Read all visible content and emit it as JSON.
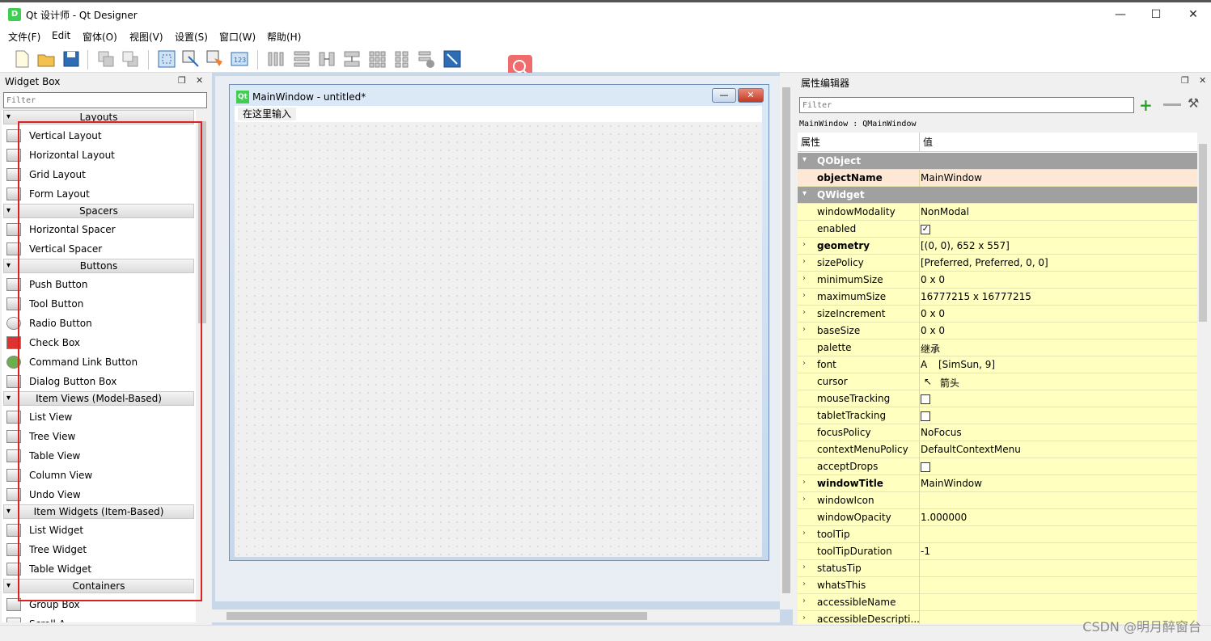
{
  "window": {
    "title": "Qt 设计师 - Qt Designer",
    "app_icon": "D",
    "controls": [
      "—",
      "☐",
      "✕"
    ]
  },
  "menu": [
    "文件(F)",
    "Edit",
    "窗体(O)",
    "视图(V)",
    "设置(S)",
    "窗口(W)",
    "帮助(H)"
  ],
  "widget_box": {
    "title": "Widget Box",
    "filter_placeholder": "Filter",
    "categories": {
      "layouts": "Layouts",
      "spacers": "Spacers",
      "buttons": "Buttons",
      "item_views": "Item Views (Model-Based)",
      "item_widgets": "Item Widgets (Item-Based)",
      "containers": "Containers"
    },
    "items": {
      "vertical_layout": "Vertical Layout",
      "horizontal_layout": "Horizontal Layout",
      "grid_layout": "Grid Layout",
      "form_layout": "Form Layout",
      "horizontal_spacer": "Horizontal Spacer",
      "vertical_spacer": "Vertical Spacer",
      "push_button": "Push Button",
      "tool_button": "Tool Button",
      "radio_button": "Radio Button",
      "check_box": "Check Box",
      "command_link_button": "Command Link Button",
      "dialog_button_box": "Dialog Button Box",
      "list_view": "List View",
      "tree_view": "Tree View",
      "table_view": "Table View",
      "column_view": "Column View",
      "undo_view": "Undo View",
      "list_widget": "List Widget",
      "tree_widget": "Tree Widget",
      "table_widget": "Table Widget",
      "group_box": "Group Box",
      "scroll_area": "Scroll A..."
    }
  },
  "form": {
    "title": "MainWindow - untitled*",
    "icon": "Qt",
    "menu_placeholder": "在这里输入"
  },
  "property_editor": {
    "title": "属性编辑器",
    "filter_placeholder": "Filter",
    "object_path": "MainWindow : QMainWindow",
    "col_property": "属性",
    "col_value": "值",
    "groups": {
      "qobject": "QObject",
      "qwidget": "QWidget"
    },
    "rows": {
      "objectName": {
        "name": "objectName",
        "value": "MainWindow"
      },
      "windowModality": {
        "name": "windowModality",
        "value": "NonModal"
      },
      "enabled": {
        "name": "enabled",
        "value": "✓"
      },
      "geometry": {
        "name": "geometry",
        "value": "[(0, 0), 652 x 557]"
      },
      "sizePolicy": {
        "name": "sizePolicy",
        "value": "[Preferred, Preferred, 0, 0]"
      },
      "minimumSize": {
        "name": "minimumSize",
        "value": "0 x 0"
      },
      "maximumSize": {
        "name": "maximumSize",
        "value": "16777215 x 16777215"
      },
      "sizeIncrement": {
        "name": "sizeIncrement",
        "value": "0 x 0"
      },
      "baseSize": {
        "name": "baseSize",
        "value": "0 x 0"
      },
      "palette": {
        "name": "palette",
        "value": "继承"
      },
      "font": {
        "name": "font",
        "value": "[SimSun, 9]"
      },
      "cursor": {
        "name": "cursor",
        "value": "箭头"
      },
      "mouseTracking": {
        "name": "mouseTracking",
        "value": ""
      },
      "tabletTracking": {
        "name": "tabletTracking",
        "value": ""
      },
      "focusPolicy": {
        "name": "focusPolicy",
        "value": "NoFocus"
      },
      "contextMenuPolicy": {
        "name": "contextMenuPolicy",
        "value": "DefaultContextMenu"
      },
      "acceptDrops": {
        "name": "acceptDrops",
        "value": ""
      },
      "windowTitle": {
        "name": "windowTitle",
        "value": "MainWindow"
      },
      "windowIcon": {
        "name": "windowIcon",
        "value": ""
      },
      "windowOpacity": {
        "name": "windowOpacity",
        "value": "1.000000"
      },
      "toolTip": {
        "name": "toolTip",
        "value": ""
      },
      "toolTipDuration": {
        "name": "toolTipDuration",
        "value": "-1"
      },
      "statusTip": {
        "name": "statusTip",
        "value": ""
      },
      "whatsThis": {
        "name": "whatsThis",
        "value": ""
      },
      "accessibleName": {
        "name": "accessibleName",
        "value": ""
      },
      "accessibleDescription": {
        "name": "accessibleDescripti...",
        "value": ""
      }
    }
  },
  "watermark": "CSDN @明月醉窗台",
  "colors": {
    "property_row": "#ffffbf",
    "group_row": "#a0a0a0",
    "highlight": "#e02020",
    "qt_green": "#41cd52"
  }
}
